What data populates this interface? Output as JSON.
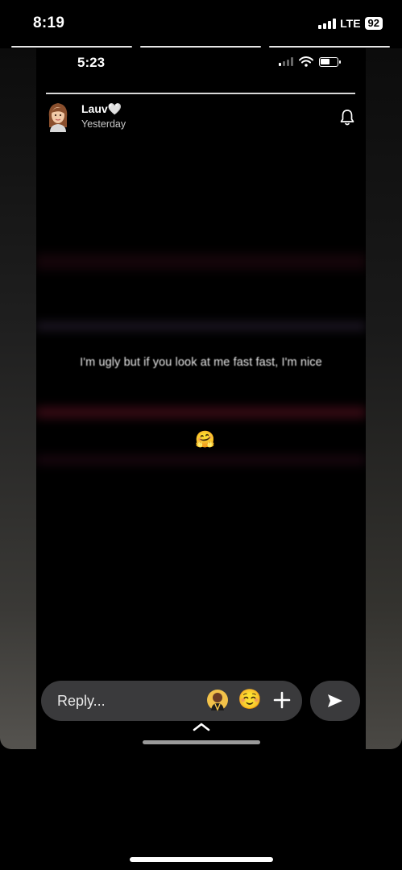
{
  "status_bar": {
    "time": "8:19",
    "network": "LTE",
    "battery": "92"
  },
  "story": {
    "inner_status": {
      "time": "5:23"
    },
    "user": {
      "name": "Lauv🤍",
      "timestamp": "Yesterday"
    },
    "caption": "I'm ugly but if you look at me fast fast, I'm nice",
    "emoji": "🤗"
  },
  "reply": {
    "placeholder": "Reply...",
    "emoji_2": "☺️"
  },
  "icons": {
    "bell": "bell-icon",
    "plus": "plus-icon",
    "send": "send-icon",
    "chevron": "chevron-up-icon"
  },
  "colors": {
    "background": "#000000",
    "bar": "#3a3a3c"
  }
}
